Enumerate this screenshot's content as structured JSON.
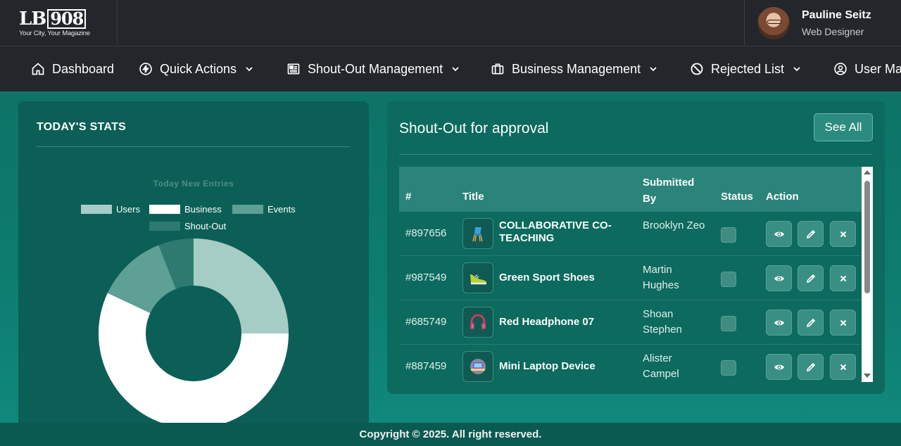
{
  "brand": {
    "logo_left": "LB",
    "logo_box": "908",
    "tagline": "Your City, Your Magazine"
  },
  "profile": {
    "name": "Pauline Seitz",
    "role": "Web Designer"
  },
  "nav": [
    {
      "label": "Dashboard",
      "icon": "home-icon"
    },
    {
      "label": "Quick Actions",
      "icon": "bolt-icon"
    },
    {
      "label": "Shout-Out Management",
      "icon": "newspaper-icon"
    },
    {
      "label": "Business Management",
      "icon": "briefcase-icon"
    },
    {
      "label": "Rejected List",
      "icon": "ban-icon"
    },
    {
      "label": "User Ma",
      "icon": "user-icon"
    }
  ],
  "stats": {
    "title": "TODAY'S STATS",
    "chart_title": "Today New Entries",
    "legend": [
      "Users",
      "Business",
      "Events",
      "Shout-Out"
    ]
  },
  "chart_data": {
    "type": "pie",
    "title": "Today New Entries",
    "categories": [
      "Users",
      "Business",
      "Events",
      "Shout-Out"
    ],
    "values": [
      25,
      57,
      12,
      6
    ],
    "colors": {
      "Users": "#a6ccc6",
      "Business": "#ffffff",
      "Events": "#5e9f96",
      "Shout-Out": "#2e7a70"
    },
    "legend_position": "top"
  },
  "approval": {
    "title": "Shout-Out for approval",
    "see_all": "See All",
    "columns": [
      "#",
      "Title",
      "Submitted By",
      "Status",
      "Action"
    ],
    "rows": [
      {
        "id": "#897656",
        "title": "COLLABORATIVE CO-TEACHING",
        "submitted_by": "Brooklyn Zeo",
        "thumb": "chair-icon"
      },
      {
        "id": "#987549",
        "title": "Green Sport Shoes",
        "submitted_by": "Martin Hughes",
        "thumb": "shoe-icon"
      },
      {
        "id": "#685749",
        "title": "Red Headphone 07",
        "submitted_by": "Shoan Stephen",
        "thumb": "headphone-icon"
      },
      {
        "id": "#887459",
        "title": "Mini Laptop Device",
        "submitted_by": "Alister Campel",
        "thumb": "laptop-icon"
      }
    ]
  },
  "footer": {
    "text": "Copyright © 2025. All right reserved."
  }
}
